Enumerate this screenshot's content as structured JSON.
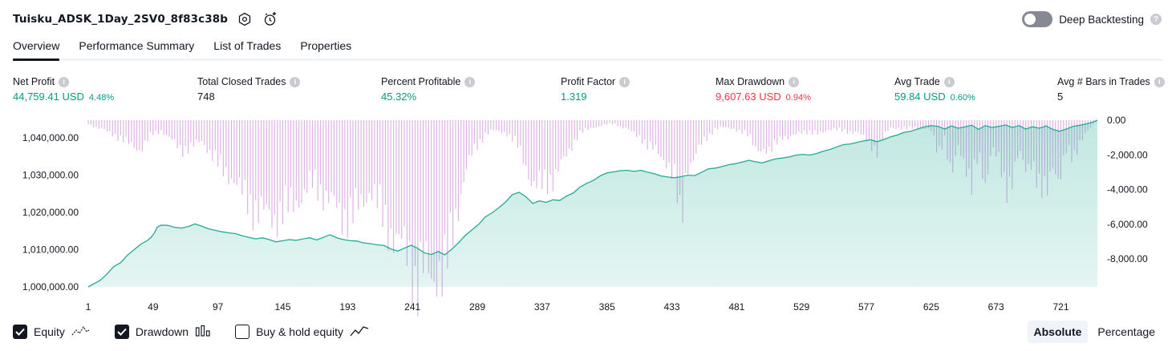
{
  "header": {
    "title": "Tuisku_ADSK_1Day_2SV0_8f83c38b",
    "deep_backtesting_label": "Deep Backtesting",
    "deep_backtesting_on": false
  },
  "tabs": [
    "Overview",
    "Performance Summary",
    "List of Trades",
    "Properties"
  ],
  "active_tab": "Overview",
  "metrics": {
    "net_profit": {
      "label": "Net Profit",
      "value": "44,759.41 USD",
      "pct": "4.48%"
    },
    "total_closed_trades": {
      "label": "Total Closed Trades",
      "value": "748"
    },
    "percent_profitable": {
      "label": "Percent Profitable",
      "value": "45.32%"
    },
    "profit_factor": {
      "label": "Profit Factor",
      "value": "1.319"
    },
    "max_drawdown": {
      "label": "Max Drawdown",
      "value": "9,607.63 USD",
      "pct": "0.94%"
    },
    "avg_trade": {
      "label": "Avg Trade",
      "value": "59.84 USD",
      "pct": "0.60%"
    },
    "avg_bars": {
      "label": "Avg # Bars in Trades",
      "value": "5"
    }
  },
  "colors": {
    "positive": "#089981",
    "negative": "#f23645",
    "equity_line": "#22ab94",
    "equity_fill": "#22ab94",
    "drawdown_bar": "#ce93d8"
  },
  "chart_data": {
    "type": "area",
    "x_ticks": [
      "1",
      "49",
      "97",
      "145",
      "193",
      "241",
      "289",
      "337",
      "385",
      "433",
      "481",
      "529",
      "577",
      "625",
      "673",
      "721"
    ],
    "left_axis": {
      "ticks": [
        "1,040,000.00",
        "1,030,000.00",
        "1,020,000.00",
        "1,010,000.00",
        "1,000,000.00"
      ],
      "range": [
        1000000,
        1044759.41
      ]
    },
    "right_axis": {
      "ticks": [
        "0.00",
        "-2,000.00",
        "-4,000.00",
        "-6,000.00",
        "-8,000.00"
      ],
      "range": [
        -9607.63,
        0
      ]
    },
    "x_range": [
      1,
      748
    ],
    "series": [
      {
        "name": "Equity",
        "points": [
          [
            1,
            1000000
          ],
          [
            5,
            1000800
          ],
          [
            10,
            1001800
          ],
          [
            15,
            1003500
          ],
          [
            20,
            1005500
          ],
          [
            25,
            1006500
          ],
          [
            30,
            1008500
          ],
          [
            35,
            1010000
          ],
          [
            40,
            1011500
          ],
          [
            45,
            1012500
          ],
          [
            48,
            1013500
          ],
          [
            50,
            1014500
          ],
          [
            52,
            1016000
          ],
          [
            55,
            1016600
          ],
          [
            60,
            1016500
          ],
          [
            65,
            1016000
          ],
          [
            70,
            1015800
          ],
          [
            75,
            1016200
          ],
          [
            80,
            1016900
          ],
          [
            85,
            1016300
          ],
          [
            90,
            1015600
          ],
          [
            95,
            1015200
          ],
          [
            100,
            1014800
          ],
          [
            105,
            1014500
          ],
          [
            110,
            1014300
          ],
          [
            115,
            1013700
          ],
          [
            120,
            1013300
          ],
          [
            125,
            1012900
          ],
          [
            130,
            1013200
          ],
          [
            135,
            1012700
          ],
          [
            140,
            1012100
          ],
          [
            145,
            1012400
          ],
          [
            150,
            1012700
          ],
          [
            155,
            1012500
          ],
          [
            160,
            1012900
          ],
          [
            165,
            1013200
          ],
          [
            170,
            1012600
          ],
          [
            175,
            1013300
          ],
          [
            180,
            1014000
          ],
          [
            185,
            1013200
          ],
          [
            190,
            1012700
          ],
          [
            195,
            1012400
          ],
          [
            200,
            1012300
          ],
          [
            205,
            1011800
          ],
          [
            210,
            1011600
          ],
          [
            215,
            1011300
          ],
          [
            220,
            1011100
          ],
          [
            225,
            1010200
          ],
          [
            230,
            1009600
          ],
          [
            235,
            1010400
          ],
          [
            240,
            1011200
          ],
          [
            245,
            1010300
          ],
          [
            250,
            1009100
          ],
          [
            255,
            1008700
          ],
          [
            260,
            1009500
          ],
          [
            265,
            1008600
          ],
          [
            270,
            1010100
          ],
          [
            275,
            1011800
          ],
          [
            280,
            1013800
          ],
          [
            285,
            1015300
          ],
          [
            290,
            1016800
          ],
          [
            295,
            1018800
          ],
          [
            300,
            1019900
          ],
          [
            305,
            1021300
          ],
          [
            310,
            1022800
          ],
          [
            315,
            1024800
          ],
          [
            320,
            1025400
          ],
          [
            325,
            1024200
          ],
          [
            330,
            1022400
          ],
          [
            335,
            1023100
          ],
          [
            340,
            1022700
          ],
          [
            345,
            1023400
          ],
          [
            350,
            1023200
          ],
          [
            355,
            1024400
          ],
          [
            360,
            1025200
          ],
          [
            365,
            1026800
          ],
          [
            370,
            1027800
          ],
          [
            375,
            1028600
          ],
          [
            380,
            1029800
          ],
          [
            385,
            1030600
          ],
          [
            390,
            1030900
          ],
          [
            395,
            1031200
          ],
          [
            400,
            1031300
          ],
          [
            405,
            1031000
          ],
          [
            410,
            1031300
          ],
          [
            415,
            1030800
          ],
          [
            420,
            1030400
          ],
          [
            425,
            1029800
          ],
          [
            430,
            1029500
          ],
          [
            435,
            1029300
          ],
          [
            440,
            1029600
          ],
          [
            445,
            1030000
          ],
          [
            450,
            1029900
          ],
          [
            455,
            1030800
          ],
          [
            460,
            1031700
          ],
          [
            465,
            1031900
          ],
          [
            470,
            1032300
          ],
          [
            475,
            1032800
          ],
          [
            480,
            1033100
          ],
          [
            485,
            1033500
          ],
          [
            490,
            1034000
          ],
          [
            495,
            1033600
          ],
          [
            500,
            1033300
          ],
          [
            505,
            1033900
          ],
          [
            510,
            1034400
          ],
          [
            515,
            1034600
          ],
          [
            520,
            1034900
          ],
          [
            525,
            1035400
          ],
          [
            530,
            1035600
          ],
          [
            535,
            1035400
          ],
          [
            540,
            1035800
          ],
          [
            545,
            1036400
          ],
          [
            550,
            1036900
          ],
          [
            555,
            1037600
          ],
          [
            560,
            1038200
          ],
          [
            565,
            1038400
          ],
          [
            570,
            1038800
          ],
          [
            575,
            1039200
          ],
          [
            580,
            1039500
          ],
          [
            585,
            1039000
          ],
          [
            590,
            1039600
          ],
          [
            595,
            1040300
          ],
          [
            600,
            1040800
          ],
          [
            605,
            1041500
          ],
          [
            610,
            1041800
          ],
          [
            615,
            1042400
          ],
          [
            620,
            1043000
          ],
          [
            625,
            1043300
          ],
          [
            630,
            1043100
          ],
          [
            635,
            1042400
          ],
          [
            640,
            1043200
          ],
          [
            645,
            1042600
          ],
          [
            650,
            1043000
          ],
          [
            655,
            1043400
          ],
          [
            660,
            1042300
          ],
          [
            665,
            1043300
          ],
          [
            670,
            1042800
          ],
          [
            675,
            1043100
          ],
          [
            680,
            1043500
          ],
          [
            685,
            1042800
          ],
          [
            690,
            1043300
          ],
          [
            695,
            1042400
          ],
          [
            700,
            1043000
          ],
          [
            705,
            1042600
          ],
          [
            710,
            1043200
          ],
          [
            715,
            1042300
          ],
          [
            720,
            1041800
          ],
          [
            725,
            1042400
          ],
          [
            730,
            1043100
          ],
          [
            735,
            1043400
          ],
          [
            740,
            1043800
          ],
          [
            745,
            1044300
          ],
          [
            748,
            1044759.41
          ]
        ]
      },
      {
        "name": "Drawdown",
        "points": [
          [
            1,
            -200
          ],
          [
            10,
            -500
          ],
          [
            20,
            -800
          ],
          [
            30,
            -1300
          ],
          [
            40,
            -1700
          ],
          [
            48,
            -800
          ],
          [
            55,
            -600
          ],
          [
            62,
            -1100
          ],
          [
            70,
            -1700
          ],
          [
            78,
            -1500
          ],
          [
            85,
            -1200
          ],
          [
            92,
            -1900
          ],
          [
            100,
            -2800
          ],
          [
            108,
            -3300
          ],
          [
            115,
            -4200
          ],
          [
            122,
            -4900
          ],
          [
            130,
            -5300
          ],
          [
            138,
            -5600
          ],
          [
            145,
            -5200
          ],
          [
            152,
            -4800
          ],
          [
            160,
            -4300
          ],
          [
            168,
            -3500
          ],
          [
            175,
            -4200
          ],
          [
            182,
            -4800
          ],
          [
            190,
            -5500
          ],
          [
            198,
            -5300
          ],
          [
            205,
            -4600
          ],
          [
            210,
            -3900
          ],
          [
            215,
            -4700
          ],
          [
            220,
            -5700
          ],
          [
            225,
            -6400
          ],
          [
            230,
            -6900
          ],
          [
            235,
            -7400
          ],
          [
            240,
            -8000
          ],
          [
            244,
            -9607.63
          ],
          [
            248,
            -8300
          ],
          [
            252,
            -8800
          ],
          [
            256,
            -9200
          ],
          [
            260,
            -8400
          ],
          [
            264,
            -8900
          ],
          [
            268,
            -7600
          ],
          [
            272,
            -6000
          ],
          [
            276,
            -4500
          ],
          [
            280,
            -3000
          ],
          [
            285,
            -2000
          ],
          [
            290,
            -1300
          ],
          [
            295,
            -800
          ],
          [
            300,
            -600
          ],
          [
            310,
            -700
          ],
          [
            318,
            -1300
          ],
          [
            325,
            -2600
          ],
          [
            330,
            -3700
          ],
          [
            335,
            -3800
          ],
          [
            340,
            -3500
          ],
          [
            345,
            -3300
          ],
          [
            350,
            -2700
          ],
          [
            355,
            -2100
          ],
          [
            360,
            -1300
          ],
          [
            365,
            -700
          ],
          [
            372,
            -500
          ],
          [
            380,
            -300
          ],
          [
            390,
            -200
          ],
          [
            400,
            -500
          ],
          [
            405,
            -800
          ],
          [
            410,
            -1000
          ],
          [
            415,
            -1400
          ],
          [
            420,
            -1700
          ],
          [
            425,
            -2100
          ],
          [
            430,
            -2400
          ],
          [
            435,
            -3300
          ],
          [
            438,
            -5000
          ],
          [
            440,
            -6600
          ],
          [
            442,
            -3700
          ],
          [
            445,
            -2600
          ],
          [
            450,
            -2100
          ],
          [
            455,
            -1400
          ],
          [
            460,
            -900
          ],
          [
            465,
            -500
          ],
          [
            470,
            -400
          ],
          [
            480,
            -500
          ],
          [
            490,
            -900
          ],
          [
            495,
            -1500
          ],
          [
            500,
            -1700
          ],
          [
            505,
            -2000
          ],
          [
            510,
            -1200
          ],
          [
            515,
            -900
          ],
          [
            520,
            -1100
          ],
          [
            525,
            -800
          ],
          [
            530,
            -600
          ],
          [
            540,
            -800
          ],
          [
            550,
            -500
          ],
          [
            560,
            -600
          ],
          [
            570,
            -700
          ],
          [
            580,
            -1300
          ],
          [
            585,
            -1800
          ],
          [
            590,
            -900
          ],
          [
            595,
            -400
          ],
          [
            605,
            -500
          ],
          [
            615,
            -400
          ],
          [
            625,
            -600
          ],
          [
            630,
            -1800
          ],
          [
            635,
            -1000
          ],
          [
            640,
            -3500
          ],
          [
            645,
            -1500
          ],
          [
            650,
            -2400
          ],
          [
            655,
            -3800
          ],
          [
            660,
            -2000
          ],
          [
            665,
            -3600
          ],
          [
            670,
            -1500
          ],
          [
            675,
            -2400
          ],
          [
            680,
            -4000
          ],
          [
            685,
            -3200
          ],
          [
            690,
            -1800
          ],
          [
            695,
            -3000
          ],
          [
            700,
            -2200
          ],
          [
            705,
            -3800
          ],
          [
            710,
            -4500
          ],
          [
            715,
            -2500
          ],
          [
            720,
            -3400
          ],
          [
            725,
            -1800
          ],
          [
            730,
            -2200
          ],
          [
            735,
            -1200
          ],
          [
            740,
            -700
          ],
          [
            745,
            -300
          ],
          [
            748,
            0
          ]
        ]
      }
    ]
  },
  "legend": [
    {
      "label": "Equity",
      "checked": true,
      "icon": "equity-line-icon"
    },
    {
      "label": "Drawdown",
      "checked": true,
      "icon": "drawdown-bars-icon"
    },
    {
      "label": "Buy & hold equity",
      "checked": false,
      "icon": "buy-hold-line-icon"
    }
  ],
  "scale_buttons": {
    "absolute": "Absolute",
    "percentage": "Percentage",
    "active": "Absolute"
  }
}
